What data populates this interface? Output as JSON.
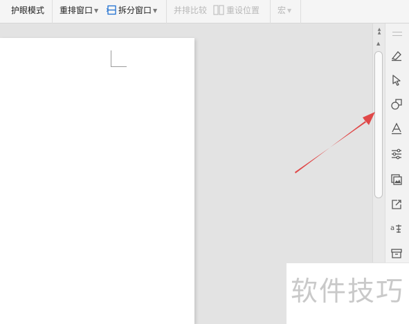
{
  "toolbar": {
    "eye_care_label": "护眼模式",
    "arrange_windows_label": "重排窗口",
    "split_window_label": "拆分窗口",
    "side_by_side_label": "并排比较",
    "reset_position_label": "重设位置",
    "macro_label": "宏"
  },
  "right_panel": {
    "icons": [
      "eraser-icon",
      "pointer-icon",
      "shapes-icon",
      "text-effect-icon",
      "filter-settings-icon",
      "image-gallery-icon",
      "share-icon",
      "translate-icon",
      "archive-icon"
    ]
  },
  "watermark": {
    "text": "软件技巧"
  },
  "colors": {
    "arrow": "#e04848",
    "accent": "#1e6fd0"
  }
}
